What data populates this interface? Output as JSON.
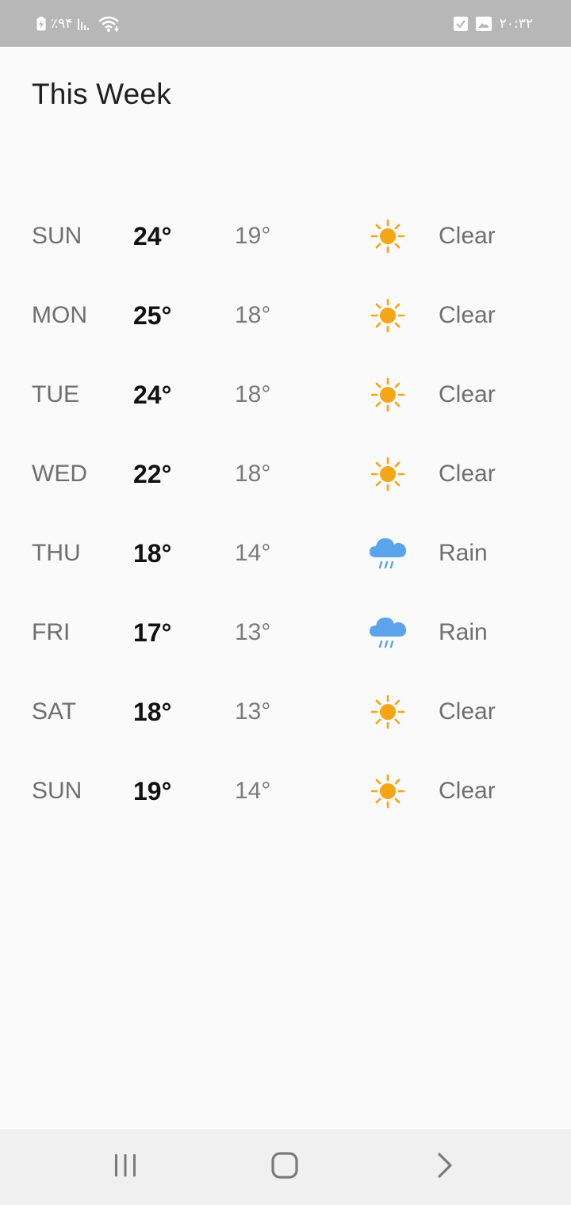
{
  "status_bar": {
    "battery_text": "٪۹۴",
    "time": "۲۰:۳۲",
    "icons": [
      "battery-charging-icon",
      "signal-icon",
      "wifi-icon",
      "checkbox-notification-icon",
      "image-notification-icon"
    ]
  },
  "header": {
    "title": "This Week"
  },
  "colors": {
    "sun": "#F5A614",
    "rain": "#5BA4EC",
    "status_bar": "#B7B7B7",
    "background": "#FAFAFA"
  },
  "forecast": [
    {
      "day": "SUN",
      "high": "24°",
      "low": "19°",
      "icon": "sun-icon",
      "condition": "Clear"
    },
    {
      "day": "MON",
      "high": "25°",
      "low": "18°",
      "icon": "sun-icon",
      "condition": "Clear"
    },
    {
      "day": "TUE",
      "high": "24°",
      "low": "18°",
      "icon": "sun-icon",
      "condition": "Clear"
    },
    {
      "day": "WED",
      "high": "22°",
      "low": "18°",
      "icon": "sun-icon",
      "condition": "Clear"
    },
    {
      "day": "THU",
      "high": "18°",
      "low": "14°",
      "icon": "rain-cloud-icon",
      "condition": "Rain"
    },
    {
      "day": "FRI",
      "high": "17°",
      "low": "13°",
      "icon": "rain-cloud-icon",
      "condition": "Rain"
    },
    {
      "day": "SAT",
      "high": "18°",
      "low": "13°",
      "icon": "sun-icon",
      "condition": "Clear"
    },
    {
      "day": "SUN",
      "high": "19°",
      "low": "14°",
      "icon": "sun-icon",
      "condition": "Clear"
    }
  ],
  "nav_bar": {
    "buttons": [
      "recent-apps-icon",
      "home-icon",
      "back-icon"
    ]
  }
}
